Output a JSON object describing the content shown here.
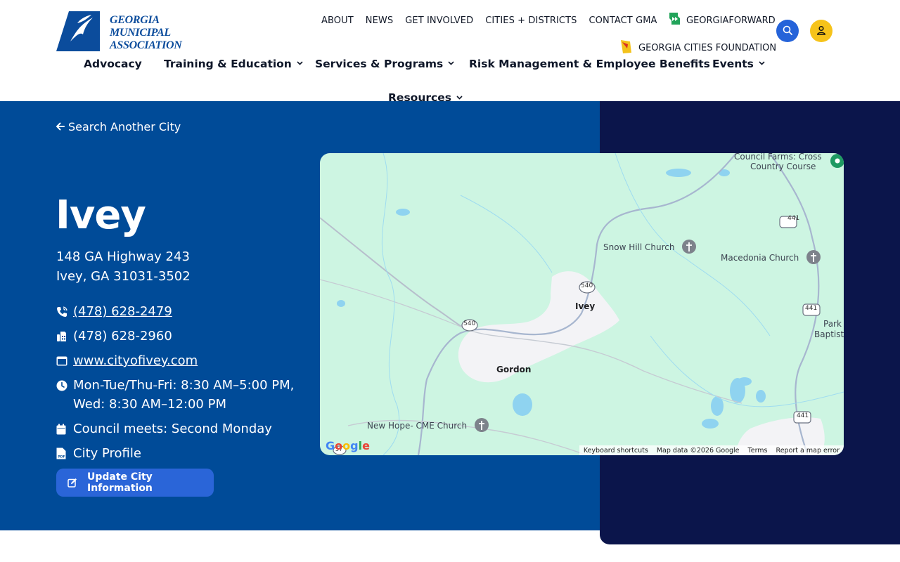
{
  "brand": {
    "logo_lines": [
      "GEORGIA",
      "MUNICIPAL",
      "ASSOCIATION"
    ],
    "primary_color": "#004b98",
    "dark_color": "#0b154b",
    "accent_blue": "#2563d9",
    "accent_yellow": "#f6c31a"
  },
  "utility_nav": {
    "items": [
      "ABOUT",
      "NEWS",
      "GET INVOLVED",
      "CITIES + DISTRICTS",
      "CONTACT GMA"
    ],
    "georgia_forward": "GEORGIAFORWARD",
    "georgia_cities_foundation": "GEORGIA CITIES FOUNDATION",
    "search_icon": "search-icon",
    "account_icon": "user-icon"
  },
  "main_nav": {
    "items": [
      {
        "label": "Advocacy",
        "has_dropdown": false
      },
      {
        "label": "Training & Education",
        "has_dropdown": true
      },
      {
        "label": "Services & Programs",
        "has_dropdown": true
      },
      {
        "label": "Risk Management & Employee Benefits",
        "has_dropdown": false
      },
      {
        "label": "Events",
        "has_dropdown": true
      },
      {
        "label": "Resources",
        "has_dropdown": true
      }
    ]
  },
  "city": {
    "back_link": "Search Another City",
    "name": "Ivey",
    "address_line1": "148 GA Highway 243",
    "address_line2": "Ivey, GA 31031-3502",
    "phone": "(478) 628-2479",
    "fax": "(478) 628-2960",
    "website": "www.cityofivey.com",
    "hours": "Mon-Tue/Thu-Fri: 8:30 AM–5:00 PM, Wed: 8:30 AM–12:00 PM",
    "council": "Council meets: Second Monday",
    "profile": "City Profile",
    "update_button": "Update City Information"
  },
  "map": {
    "places": {
      "council_farms_1": "Council Farms: Cross",
      "council_farms_2": "Country Course",
      "snow_hill": "Snow Hill Church",
      "macedonia": "Macedonia Church",
      "ivey": "Ivey",
      "gordon": "Gordon",
      "new_hope": "New Hope- CME Church",
      "park_1": "Park",
      "park_2": "Baptist C"
    },
    "road_shields": [
      "441",
      "441",
      "441",
      "540",
      "540",
      "57"
    ],
    "google": "Google",
    "footer": [
      "Keyboard shortcuts",
      "Map data ©2026 Google",
      "Terms",
      "Report a map error"
    ]
  }
}
